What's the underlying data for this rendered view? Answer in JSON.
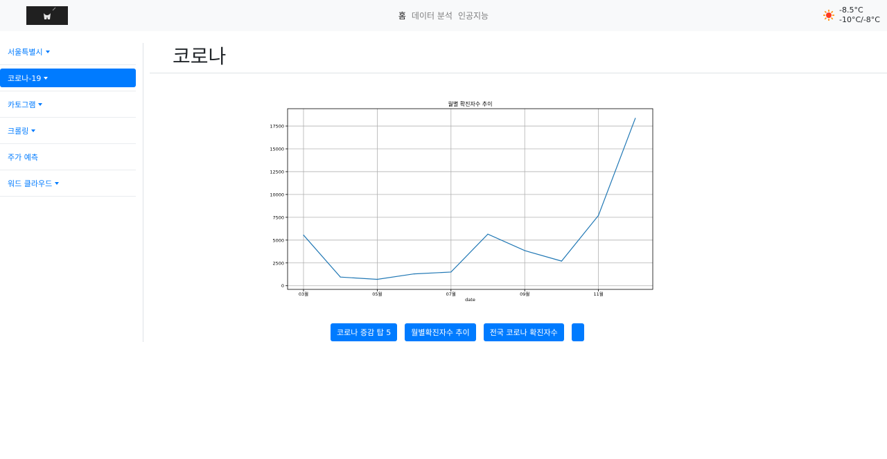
{
  "navbar": {
    "links": [
      {
        "label": "홈",
        "active": true
      },
      {
        "label": "데이터 분석",
        "active": false
      },
      {
        "label": "인공지능",
        "active": false
      }
    ],
    "weather": {
      "icon": "sun-icon",
      "current": "-8.5°C",
      "range": "-10°C/-8°C"
    }
  },
  "sidebar": {
    "items": [
      {
        "label": "서울특별시",
        "dropdown": true,
        "active": false
      },
      {
        "label": "코로나-19",
        "dropdown": true,
        "active": true
      },
      {
        "label": "카토그램",
        "dropdown": true,
        "active": false
      },
      {
        "label": "크롤링",
        "dropdown": true,
        "active": false
      },
      {
        "label": "주가 예측",
        "dropdown": false,
        "active": false
      },
      {
        "label": "워드 클라우드",
        "dropdown": true,
        "active": false
      }
    ]
  },
  "main": {
    "title": "코로나",
    "buttons": [
      {
        "label": "코로나 증감 탑 5"
      },
      {
        "label": "월별확진자수 추이"
      },
      {
        "label": "전국 코로나 확진자수"
      },
      {
        "label": ""
      }
    ]
  },
  "colors": {
    "primary": "#007bff",
    "line": "#1f77b4",
    "navbar_bg": "#f8f9fa"
  },
  "chart_data": {
    "type": "line",
    "title": "월별 확진자수 추이",
    "xlabel": "date",
    "ylabel": "",
    "x": [
      "2020-03",
      "2020-04",
      "2020-05",
      "2020-06",
      "2020-07",
      "2020-08",
      "2020-09",
      "2020-10",
      "2020-11",
      "2020-12"
    ],
    "x_tick_labels": [
      "03월",
      "05월",
      "07월",
      "09월",
      "11월"
    ],
    "x_tick_positions": [
      "2020-03",
      "2020-05",
      "2020-07",
      "2020-09",
      "2020-11"
    ],
    "values": [
      5550,
      950,
      700,
      1300,
      1500,
      5650,
      3850,
      2700,
      7700,
      18350
    ],
    "y_ticks": [
      0,
      2500,
      5000,
      7500,
      10000,
      12500,
      15000,
      17500
    ],
    "ylim": [
      -400,
      19400
    ],
    "grid": true
  }
}
